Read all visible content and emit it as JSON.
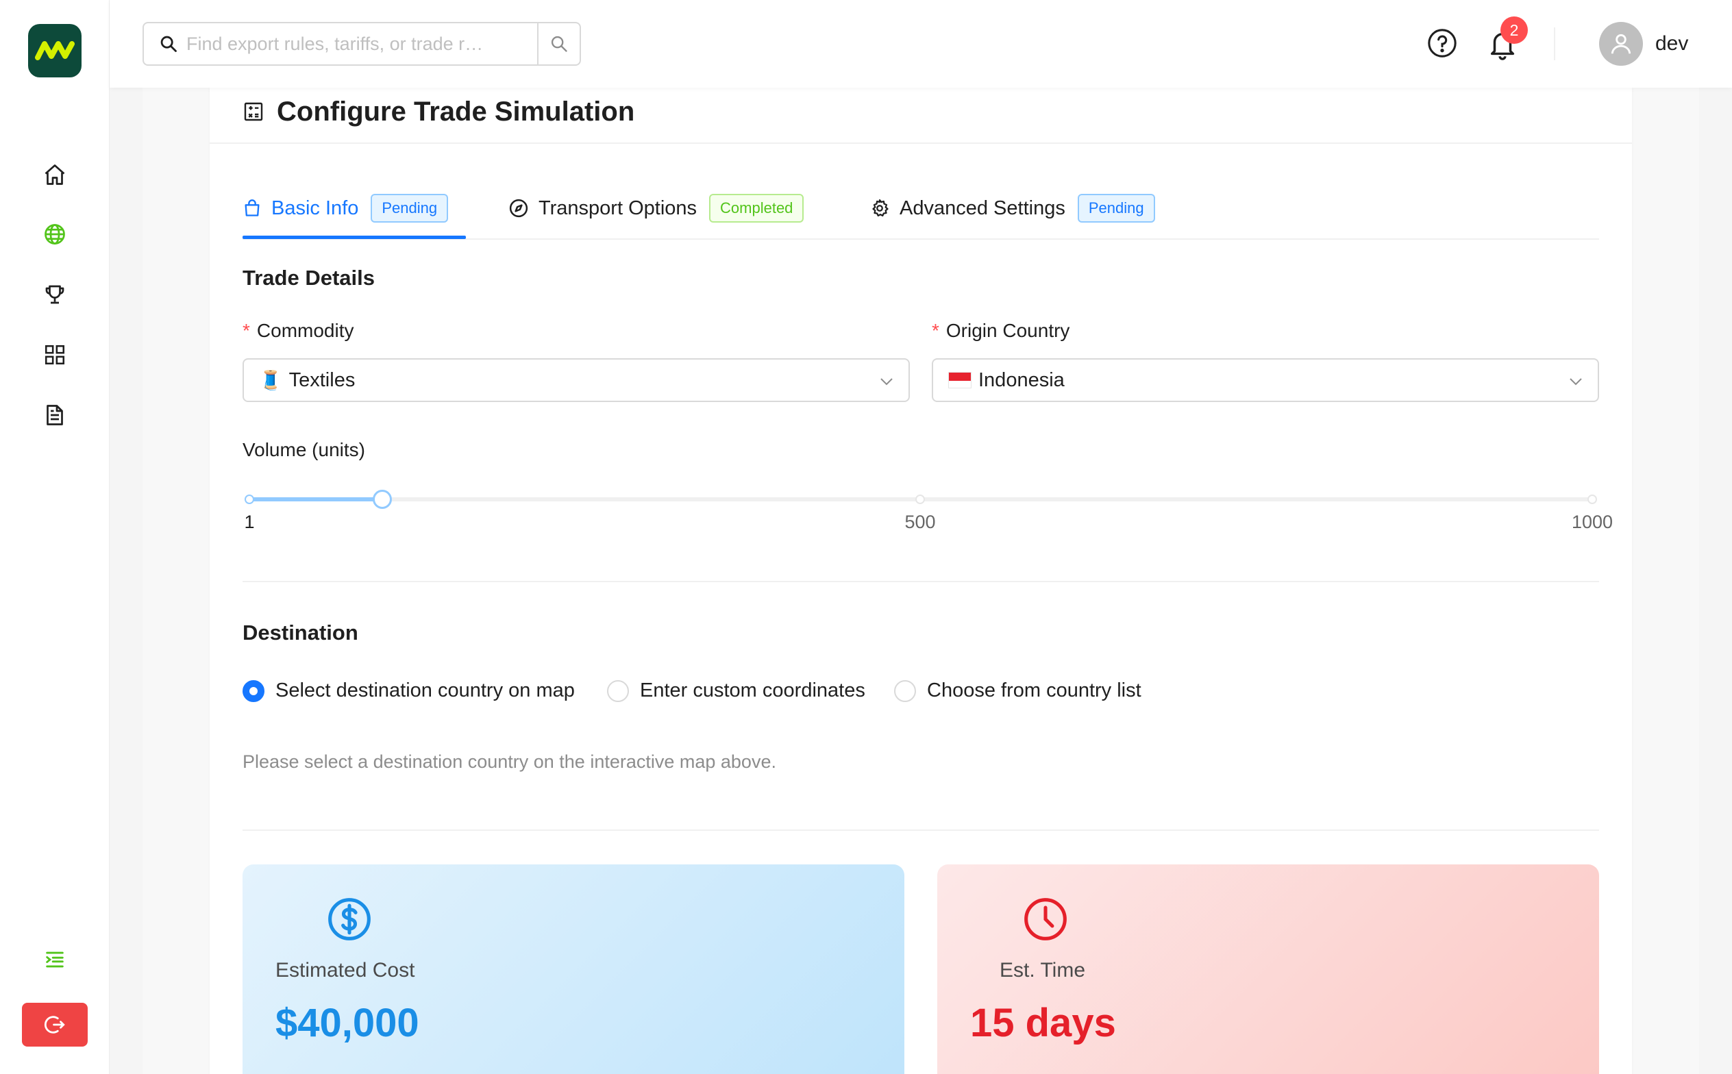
{
  "app": {
    "user_name": "dev",
    "notification_count": "2"
  },
  "search": {
    "placeholder": "Find export rules, tariffs, or trade r…"
  },
  "page": {
    "title": "Configure Trade Simulation"
  },
  "tabs": [
    {
      "label": "Basic Info",
      "status": "Pending",
      "active": true
    },
    {
      "label": "Transport Options",
      "status": "Completed",
      "active": false
    },
    {
      "label": "Advanced Settings",
      "status": "Pending",
      "active": false
    }
  ],
  "trade_details": {
    "title": "Trade Details",
    "commodity_label": "Commodity",
    "commodity_value": "Textiles",
    "commodity_icon": "🧵",
    "origin_label": "Origin Country",
    "origin_value": "Indonesia",
    "origin_icon": "🇮🇩",
    "required_mark": "*"
  },
  "volume": {
    "label": "Volume (units)",
    "min": 1,
    "max": 1000,
    "value": 100,
    "marks": [
      "1",
      "500",
      "1000"
    ]
  },
  "destination": {
    "title": "Destination",
    "options": [
      {
        "label": "Select destination country on map",
        "checked": true
      },
      {
        "label": "Enter custom coordinates",
        "checked": false
      },
      {
        "label": "Choose from country list",
        "checked": false
      }
    ],
    "hint": "Please select a destination country on the interactive map above."
  },
  "stats": {
    "cost_label": "Estimated Cost",
    "cost_value": "$40,000",
    "time_label": "Est. Time",
    "time_value": "15 days"
  },
  "colors": {
    "primary": "#1677ff",
    "cost_value": "#1a8ee6",
    "time_value": "#e5202a",
    "logout": "#ef4444",
    "brand_dark": "#0d4a3a",
    "brand_lime": "#d4f000"
  }
}
